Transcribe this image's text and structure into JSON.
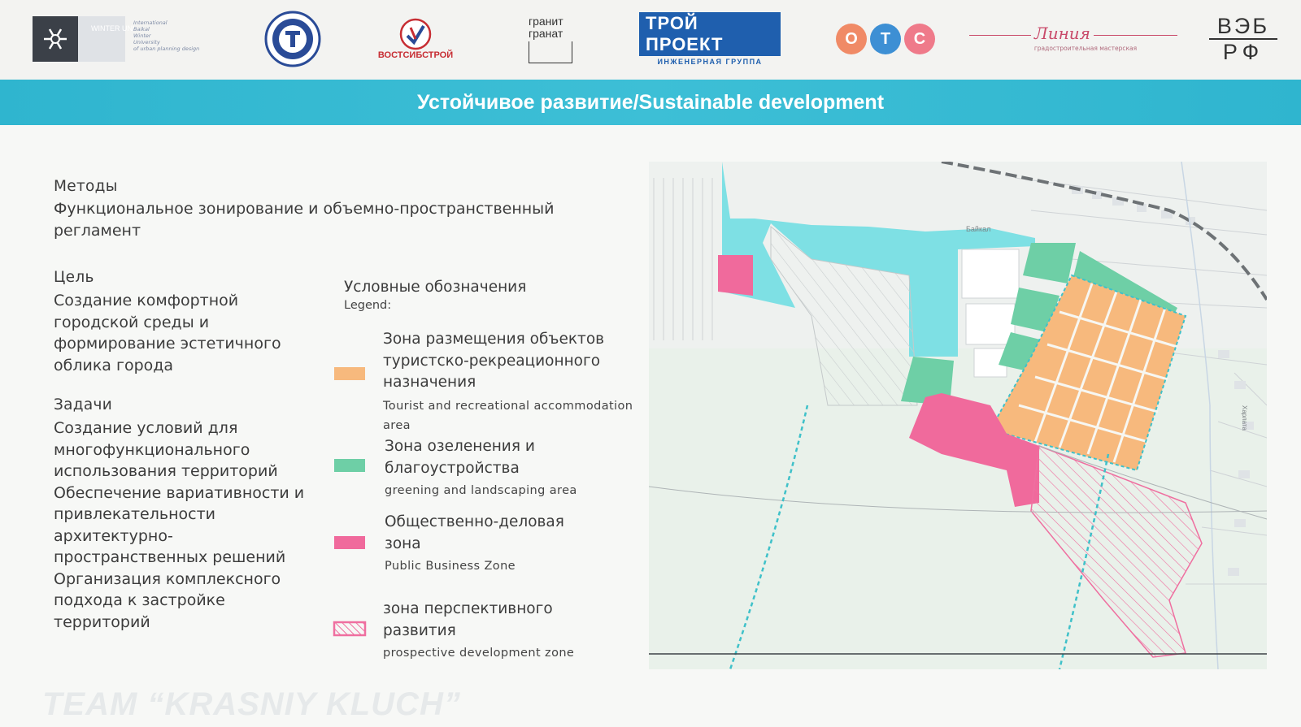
{
  "logos": {
    "winter_uni": {
      "name": "WINTER UNI",
      "text": [
        "International",
        "Baikal",
        "Winter",
        "University",
        "of urban planning design"
      ]
    },
    "university_emblem": {
      "name": "university-emblem"
    },
    "vostsibstroy": {
      "text": "ВОСТСИБСТРОЙ"
    },
    "granit": {
      "line1": "гранит",
      "line2": "гранат"
    },
    "troyproekt": {
      "line1": "ТРОЙ ПРОЕКТ",
      "line2": "ИНЖЕНЕРНАЯ ГРУППА"
    },
    "ots": {
      "letters": [
        "О",
        "Т",
        "С"
      ]
    },
    "liniya": {
      "text": "Линия",
      "subtitle": "градостроительная мастерская"
    },
    "veb": {
      "line1": "ВЭБ",
      "line2": "РФ"
    }
  },
  "banner": {
    "title": "Устойчивое развитие/Sustainable development"
  },
  "methods": {
    "heading": "Методы",
    "body": [
      "Функциональное зонирование и объемно-пространственный",
      "регламент"
    ]
  },
  "goal": {
    "heading": "Цель",
    "body": [
      "Создание комфортной",
      "городской среды и",
      "формирование эстетичного",
      "облика города"
    ]
  },
  "tasks": {
    "heading": "Задачи",
    "body": [
      "Создание условий для",
      "многофункционального",
      "использования территорий",
      "Обеспечение вариативности и",
      "привлекательности",
      "архитектурно-",
      "пространственных решений",
      "Организация комплексного",
      "подхода к застройке",
      "территорий"
    ]
  },
  "legend": {
    "title": "Условные обозначения",
    "subtitle": "Legend:",
    "items": [
      {
        "ru": [
          "Зона размещения объектов",
          "туристско-рекреационного",
          "назначения"
        ],
        "en": [
          "Tourist and recreational accommodation",
          "area"
        ],
        "color": "#f7b97d"
      },
      {
        "ru": [
          "Зона озеленения и",
          "благоустройства"
        ],
        "en": [
          "greening and landscaping area"
        ],
        "color": "#6ecfa6"
      },
      {
        "ru": [
          "Общественно-деловая",
          "зона"
        ],
        "en": [
          "Public Business Zone"
        ],
        "color": "#f06a9c"
      },
      {
        "ru": [
          "зона перспективного",
          "развития"
        ],
        "en": [
          "prospective development zone"
        ],
        "color": "#ef6fa0"
      }
    ]
  },
  "map": {
    "road_label": "Байкал",
    "street_label": "Харлата"
  },
  "footer": {
    "team": "TEAM “KRASNIY KLUCH”"
  },
  "colors": {
    "banner": "#35b9d2",
    "tourist": "#f7b97d",
    "greening": "#6ecfa6",
    "business": "#f06a9c",
    "water": "#7ee0e4"
  }
}
